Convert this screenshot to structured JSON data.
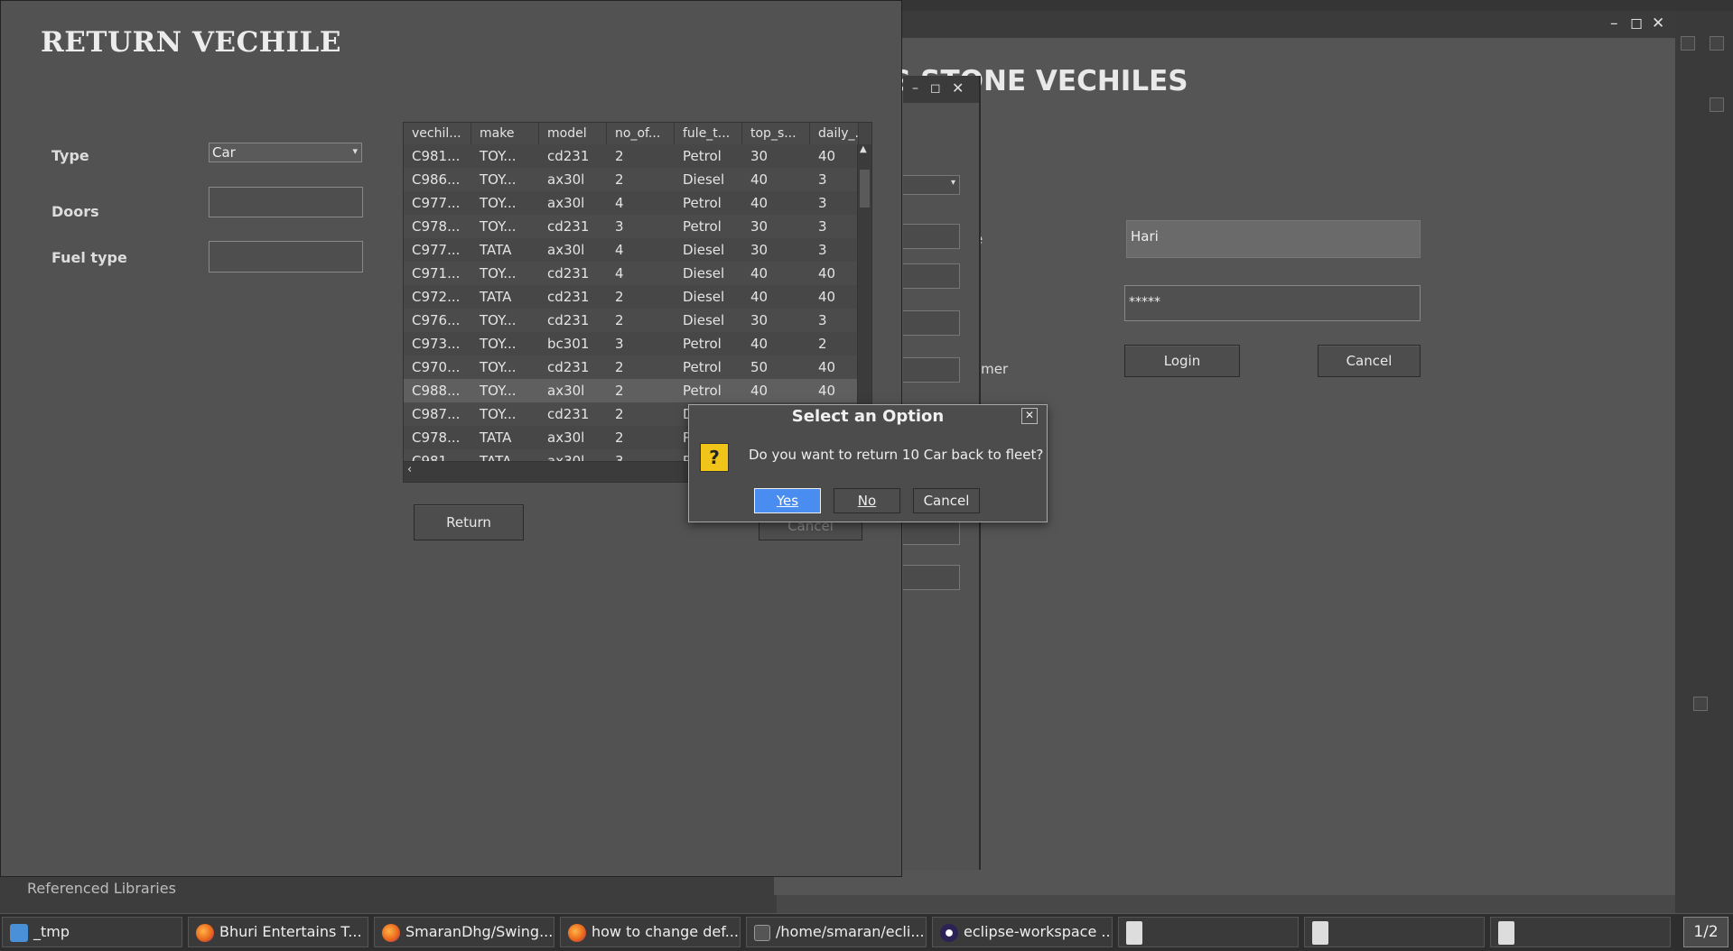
{
  "return_window": {
    "title": "RETURN VECHILE",
    "labels": {
      "type": "Type",
      "doors": "Doors",
      "fuel": "Fuel type"
    },
    "type_value": "Car",
    "doors_value": "",
    "fuel_value": "",
    "return_label": "Return",
    "cancel_label": "Cancel"
  },
  "table": {
    "columns": [
      "vechil...",
      "make",
      "model",
      "no_of...",
      "fule_t...",
      "top_s...",
      "daily_..."
    ],
    "rows": [
      [
        "C981...",
        "TOY...",
        "cd231",
        "2",
        "Petrol",
        "30",
        "40"
      ],
      [
        "C986...",
        "TOY...",
        "ax30l",
        "2",
        "Diesel",
        "40",
        "3"
      ],
      [
        "C977...",
        "TOY...",
        "ax30l",
        "4",
        "Petrol",
        "40",
        "3"
      ],
      [
        "C978...",
        "TOY...",
        "cd231",
        "3",
        "Petrol",
        "30",
        "3"
      ],
      [
        "C977...",
        "TATA",
        "ax30l",
        "4",
        "Diesel",
        "30",
        "3"
      ],
      [
        "C971...",
        "TOY...",
        "cd231",
        "4",
        "Diesel",
        "40",
        "40"
      ],
      [
        "C972...",
        "TATA",
        "cd231",
        "2",
        "Diesel",
        "40",
        "40"
      ],
      [
        "C976...",
        "TOY...",
        "cd231",
        "2",
        "Diesel",
        "30",
        "3"
      ],
      [
        "C973...",
        "TOY...",
        "bc301",
        "3",
        "Petrol",
        "40",
        "2"
      ],
      [
        "C970...",
        "TOY...",
        "cd231",
        "2",
        "Petrol",
        "50",
        "40"
      ],
      [
        "C988...",
        "TOY...",
        "ax30l",
        "2",
        "Petrol",
        "40",
        "40"
      ],
      [
        "C987...",
        "TOY...",
        "cd231",
        "2",
        "D",
        "",
        ""
      ],
      [
        "C978...",
        "TATA",
        "ax30l",
        "2",
        "P",
        "",
        ""
      ],
      [
        "C981...",
        "TATA",
        "ax30l",
        "3",
        "P",
        "",
        ""
      ]
    ],
    "selected_row": 10
  },
  "dialog": {
    "title": "Select an Option",
    "message": "Do you want to return 10 Car back to fleet?",
    "yes": "Yes",
    "no": "No",
    "cancel": "Cancel",
    "icon": "question-icon"
  },
  "login_window": {
    "heading": "NG STONE VECHILES",
    "name_label_fragment": "e",
    "customer_label_fragment": "omer",
    "username": "Hari",
    "password": "*****",
    "login_label": "Login",
    "cancel_label": "Cancel"
  },
  "eclipse": {
    "tree_item": "Referenced Libraries"
  },
  "taskbar": {
    "items": [
      {
        "label": "_tmp",
        "icon": "file-manager-icon"
      },
      {
        "label": "Bhuri Entertains T...",
        "icon": "firefox-icon"
      },
      {
        "label": "SmaranDhg/Swing...",
        "icon": "firefox-icon"
      },
      {
        "label": "how to change def...",
        "icon": "firefox-icon"
      },
      {
        "label": "/home/smaran/ecli...",
        "icon": "terminal-icon"
      },
      {
        "label": "eclipse-workspace ...",
        "icon": "eclipse-icon"
      },
      {
        "label": "",
        "icon": "java-icon"
      },
      {
        "label": "",
        "icon": "java-icon"
      },
      {
        "label": "",
        "icon": "java-icon"
      }
    ],
    "workspace": "1/2"
  }
}
